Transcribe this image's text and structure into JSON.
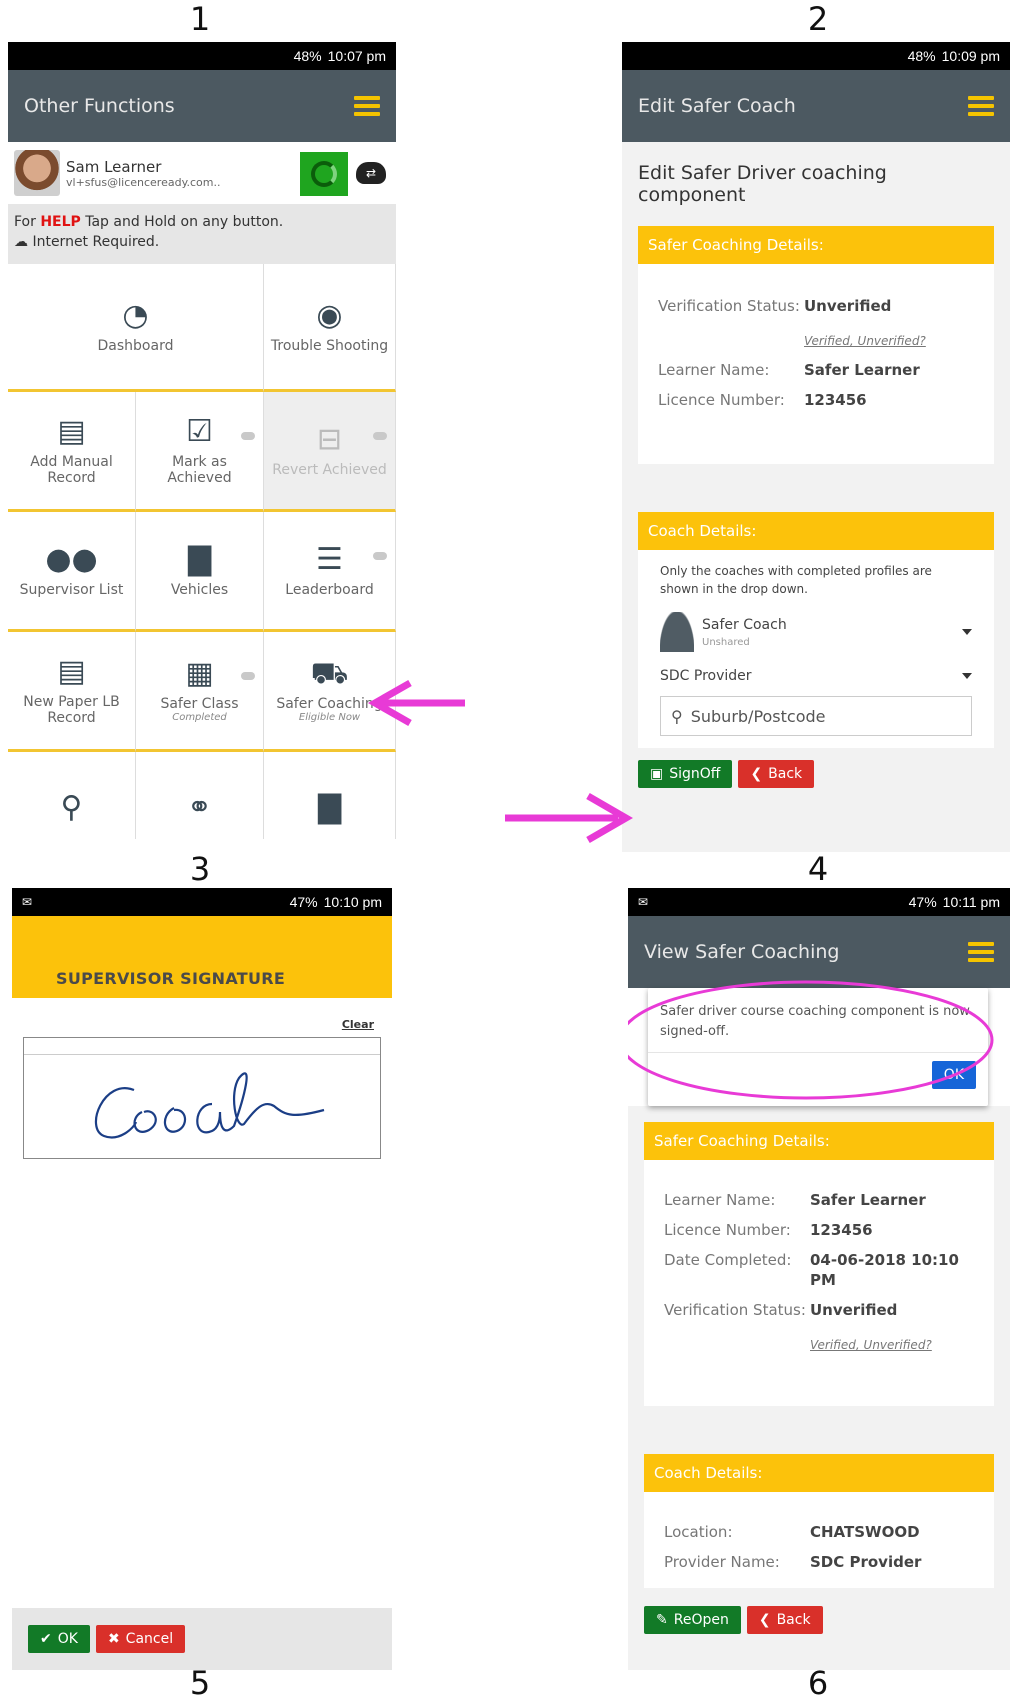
{
  "steps": [
    "1",
    "2",
    "3",
    "4",
    "5",
    "6"
  ],
  "status": {
    "p1": {
      "battery": "48%",
      "time": "10:07 pm"
    },
    "p2": {
      "battery": "48%",
      "time": "10:09 pm"
    },
    "p3": {
      "battery": "47%",
      "time": "10:10 pm"
    },
    "p4": {
      "battery": "47%",
      "time": "10:11 pm"
    }
  },
  "p1": {
    "title": "Other Functions",
    "user_name": "Sam Learner",
    "user_email": "vl+sfus@licenceready.com..",
    "help_prefix": "For ",
    "help_word": "HELP",
    "help_suffix": " Tap and Hold on any button.",
    "internet": "Internet Required.",
    "tiles": [
      {
        "label": "Dashboard",
        "icon": "◔"
      },
      {
        "label": "Trouble Shooting",
        "icon": "◉"
      },
      {
        "label": "Add Manual Record",
        "icon": "▤"
      },
      {
        "label": "Mark as Achieved",
        "icon": "☑"
      },
      {
        "label": "Revert Achieved",
        "icon": "⊟"
      },
      {
        "label": "Supervisor List",
        "icon": "●●"
      },
      {
        "label": "Vehicles",
        "icon": "▇"
      },
      {
        "label": "Leaderboard",
        "icon": "☰"
      },
      {
        "label": "New Paper LB Record",
        "icon": "▤"
      },
      {
        "label": "Safer Class",
        "sub": "Completed",
        "icon": "▦"
      },
      {
        "label": "Safer Coaching",
        "sub": "Eligible Now",
        "icon": "⛟"
      }
    ]
  },
  "p2": {
    "title": "Edit Safer Coach",
    "heading": "Edit Safer Driver coaching component",
    "details_head": "Safer Coaching Details:",
    "verification_label": "Verification Status:",
    "verification_value": "Unverified",
    "verification_link": "Verified, Unverified?",
    "learner_label": "Learner Name:",
    "learner_value": "Safer Learner",
    "licence_label": "Licence Number:",
    "licence_value": "123456",
    "coach_head": "Coach Details:",
    "coach_note": "Only the coaches with completed profiles are shown in the drop down.",
    "coach_name": "Safer Coach",
    "coach_sub": "Unshared",
    "provider": "SDC Provider",
    "search_placeholder": "Suburb/Postcode",
    "signoff": "SignOff",
    "back": "Back"
  },
  "p3": {
    "title": "SUPERVISOR SIGNATURE",
    "clear": "Clear",
    "signature": "Coach",
    "ok": "OK",
    "cancel": "Cancel"
  },
  "p4": {
    "title": "View Safer Coaching",
    "dialog_text": "Safer driver course coaching component is now signed-off.",
    "dialog_ok": "OK",
    "details_head": "Safer Coaching Details:",
    "learner_label": "Learner Name:",
    "learner_value": "Safer Learner",
    "licence_label": "Licence Number:",
    "licence_value": "123456",
    "date_label": "Date Completed:",
    "date_value": "04-06-2018 10:10 PM",
    "verification_label": "Verification Status:",
    "verification_value": "Unverified",
    "verification_link": "Verified, Unverified?",
    "coach_head": "Coach Details:",
    "location_label": "Location:",
    "location_value": "CHATSWOOD",
    "provider_label": "Provider Name:",
    "provider_value": "SDC Provider",
    "reopen": "ReOpen",
    "back": "Back"
  },
  "colors": {
    "accent": "#fcc20b",
    "appbar": "#4c5961",
    "arrow": "#e83ad6",
    "green": "#127a27",
    "red": "#d9302a"
  }
}
